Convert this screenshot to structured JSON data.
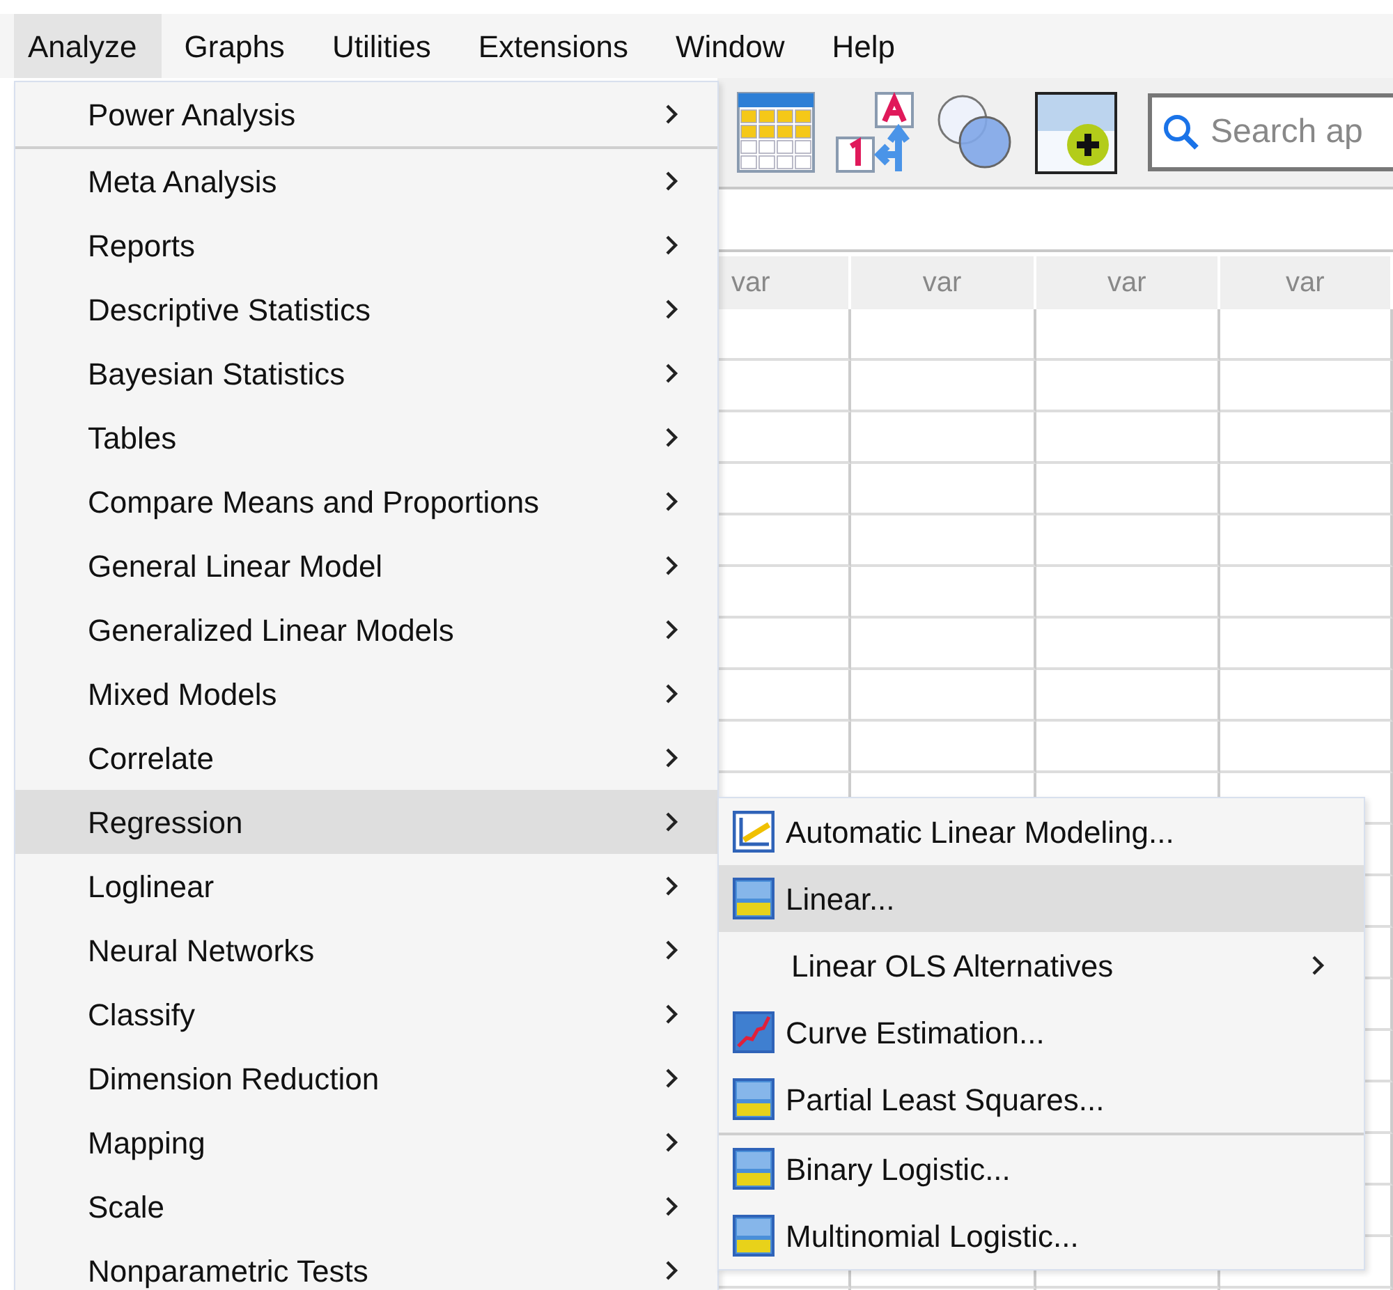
{
  "menubar": [
    {
      "label": "Analyze",
      "selected": true
    },
    {
      "label": "Graphs",
      "selected": false
    },
    {
      "label": "Utilities",
      "selected": false
    },
    {
      "label": "Extensions",
      "selected": false
    },
    {
      "label": "Window",
      "selected": false
    },
    {
      "label": "Help",
      "selected": false
    }
  ],
  "toolbar": {
    "search": {
      "placeholder": "Search ap"
    }
  },
  "grid": {
    "columns": [
      "var",
      "var",
      "var",
      "var"
    ]
  },
  "analyze_menu": [
    {
      "label": "Power Analysis",
      "has_submenu": true,
      "selected": false,
      "separator_after": true
    },
    {
      "label": "Meta Analysis",
      "has_submenu": true,
      "selected": false,
      "separator_after": false
    },
    {
      "label": "Reports",
      "has_submenu": true,
      "selected": false,
      "separator_after": false
    },
    {
      "label": "Descriptive Statistics",
      "has_submenu": true,
      "selected": false,
      "separator_after": false
    },
    {
      "label": "Bayesian Statistics",
      "has_submenu": true,
      "selected": false,
      "separator_after": false
    },
    {
      "label": "Tables",
      "has_submenu": true,
      "selected": false,
      "separator_after": false
    },
    {
      "label": "Compare Means and Proportions",
      "has_submenu": true,
      "selected": false,
      "separator_after": false
    },
    {
      "label": "General Linear Model",
      "has_submenu": true,
      "selected": false,
      "separator_after": false
    },
    {
      "label": "Generalized Linear Models",
      "has_submenu": true,
      "selected": false,
      "separator_after": false
    },
    {
      "label": "Mixed Models",
      "has_submenu": true,
      "selected": false,
      "separator_after": false
    },
    {
      "label": "Correlate",
      "has_submenu": true,
      "selected": false,
      "separator_after": false
    },
    {
      "label": "Regression",
      "has_submenu": true,
      "selected": true,
      "separator_after": false
    },
    {
      "label": "Loglinear",
      "has_submenu": true,
      "selected": false,
      "separator_after": false
    },
    {
      "label": "Neural Networks",
      "has_submenu": true,
      "selected": false,
      "separator_after": false
    },
    {
      "label": "Classify",
      "has_submenu": true,
      "selected": false,
      "separator_after": false
    },
    {
      "label": "Dimension Reduction",
      "has_submenu": true,
      "selected": false,
      "separator_after": false
    },
    {
      "label": "Mapping",
      "has_submenu": true,
      "selected": false,
      "separator_after": false
    },
    {
      "label": "Scale",
      "has_submenu": true,
      "selected": false,
      "separator_after": false
    },
    {
      "label": "Nonparametric Tests",
      "has_submenu": true,
      "selected": false,
      "separator_after": false
    }
  ],
  "regression_submenu": [
    {
      "label": "Automatic Linear Modeling...",
      "kind": "auto",
      "has_submenu": false,
      "selected": false,
      "separator_after": false
    },
    {
      "label": "Linear...",
      "kind": "r-model",
      "has_submenu": false,
      "selected": true,
      "separator_after": false
    },
    {
      "label": "Linear OLS Alternatives",
      "kind": "none",
      "has_submenu": true,
      "selected": false,
      "separator_after": false
    },
    {
      "label": "Curve Estimation...",
      "kind": "curve",
      "has_submenu": false,
      "selected": false,
      "separator_after": false
    },
    {
      "label": "Partial Least Squares...",
      "kind": "r-model",
      "has_submenu": false,
      "selected": false,
      "separator_after": true
    },
    {
      "label": "Binary Logistic...",
      "kind": "r-model",
      "has_submenu": false,
      "selected": false,
      "separator_after": false
    },
    {
      "label": "Multinomial Logistic...",
      "kind": "r-model",
      "has_submenu": false,
      "selected": false,
      "separator_after": false
    }
  ]
}
